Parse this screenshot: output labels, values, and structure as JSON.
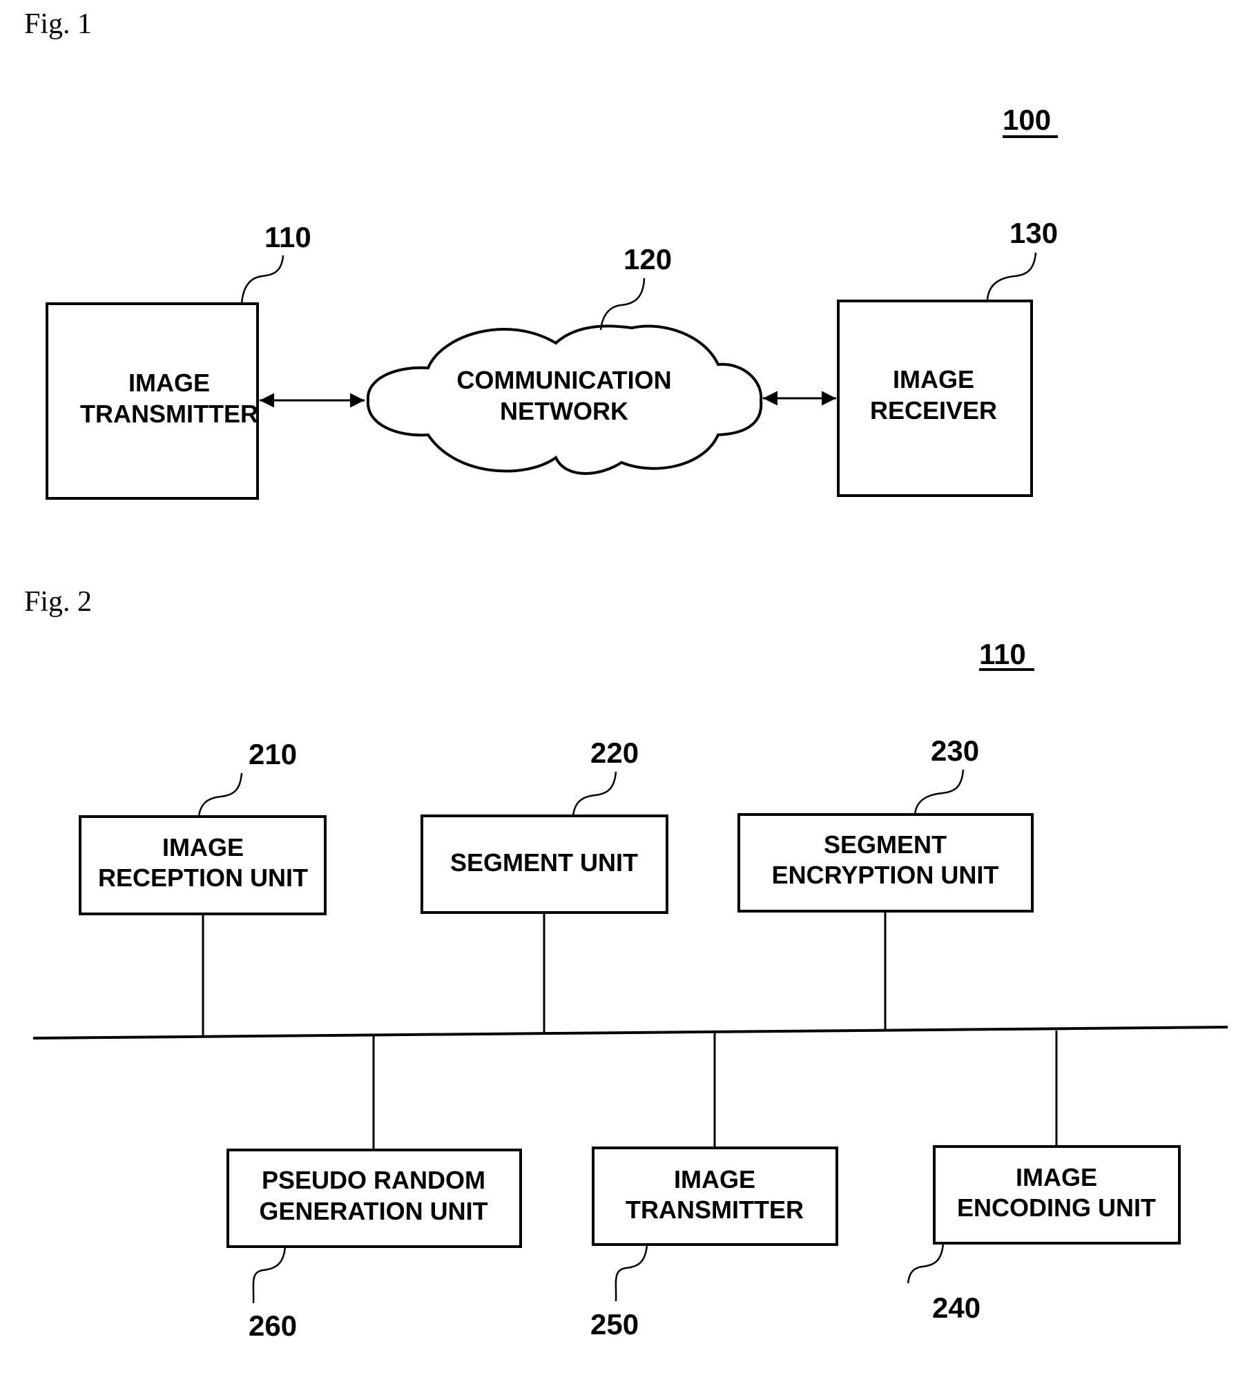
{
  "figure1": {
    "title": "Fig. 1",
    "system_ref": "100",
    "nodes": [
      {
        "id": "110",
        "ref": "110",
        "lines": [
          "IMAGE",
          "TRANSMITTER"
        ]
      },
      {
        "id": "120",
        "ref": "120",
        "lines": [
          "COMMUNICATION",
          "NETWORK"
        ],
        "shape": "cloud"
      },
      {
        "id": "130",
        "ref": "130",
        "lines": [
          "IMAGE",
          "RECEIVER"
        ]
      }
    ],
    "connections": [
      {
        "from": "110",
        "to": "120",
        "type": "bidirectional-arrow"
      },
      {
        "from": "120",
        "to": "130",
        "type": "bidirectional-arrow"
      }
    ]
  },
  "figure2": {
    "title": "Fig. 2",
    "system_ref": "110",
    "top_units": [
      {
        "ref": "210",
        "lines": [
          "IMAGE",
          "RECEPTION UNIT"
        ]
      },
      {
        "ref": "220",
        "lines": [
          "SEGMENT UNIT"
        ]
      },
      {
        "ref": "230",
        "lines": [
          "SEGMENT",
          "ENCRYPTION UNIT"
        ]
      }
    ],
    "bottom_units": [
      {
        "ref": "260",
        "lines": [
          "PSEUDO RANDOM",
          "GENERATION UNIT"
        ]
      },
      {
        "ref": "250",
        "lines": [
          "IMAGE",
          "TRANSMITTER"
        ]
      },
      {
        "ref": "240",
        "lines": [
          "IMAGE",
          "ENCODING UNIT"
        ]
      }
    ],
    "bus": "shared-bus"
  }
}
